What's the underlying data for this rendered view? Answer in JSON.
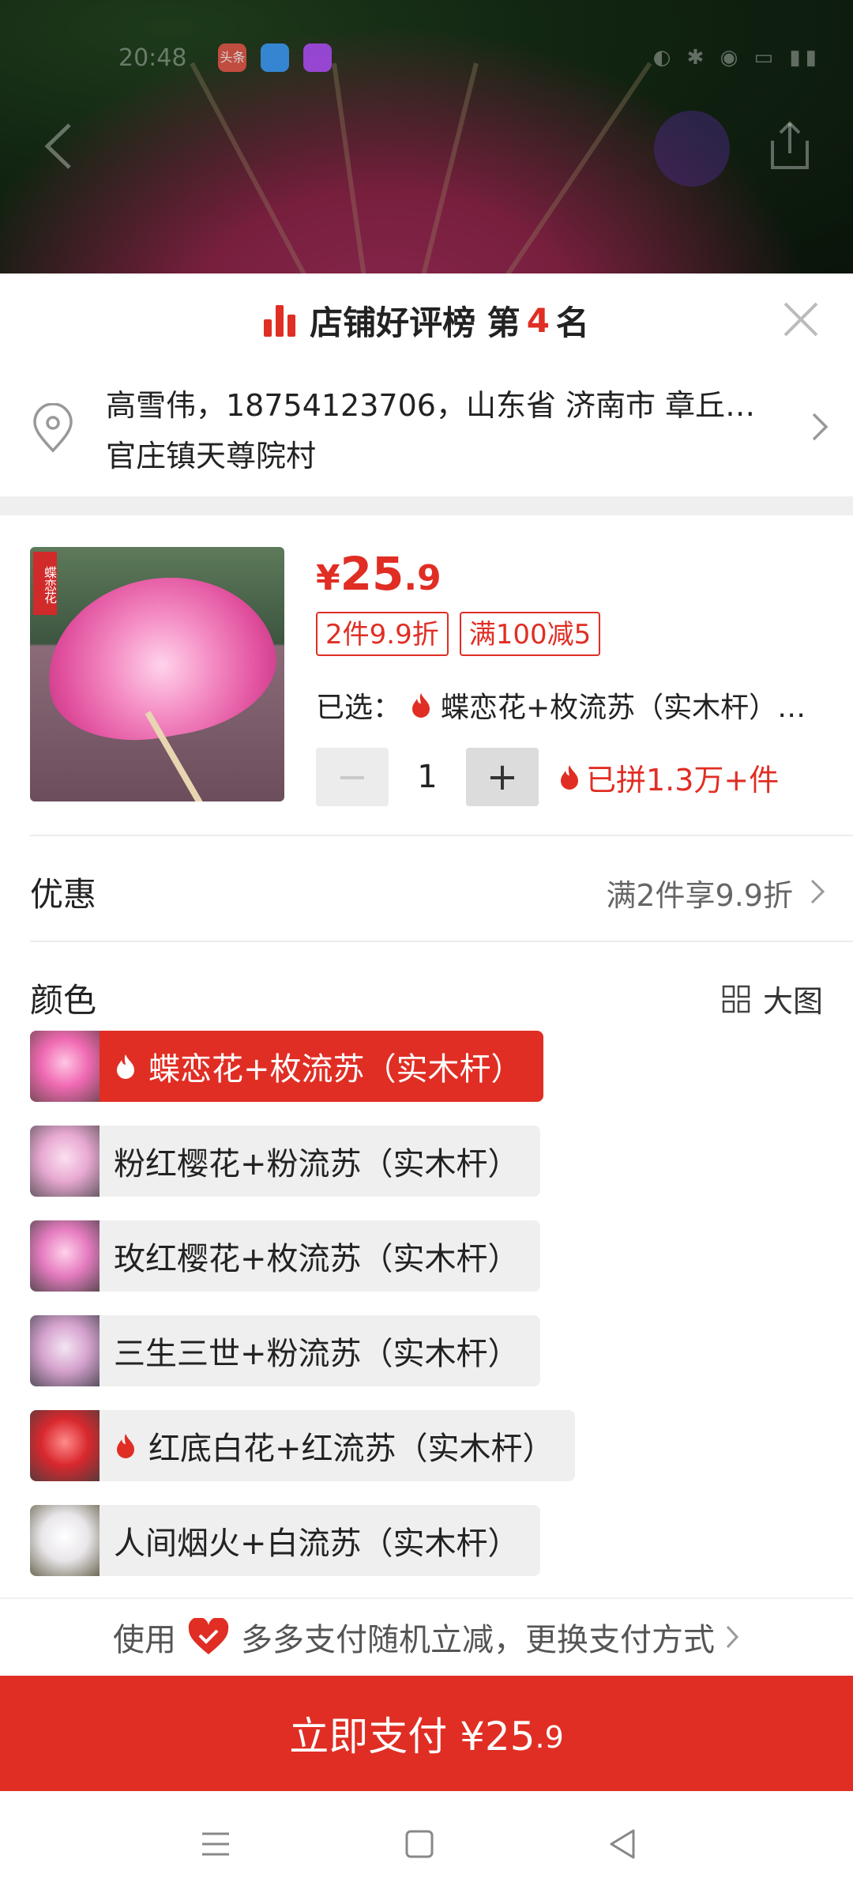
{
  "status_bar": {
    "time": "20:48",
    "apps": [
      "头条",
      "",
      ""
    ]
  },
  "top": {
    "back": "back",
    "share": "share"
  },
  "rank": {
    "prefix": "店铺好评榜 第",
    "number": "4",
    "suffix": "名"
  },
  "address": {
    "line1": "高雪伟，18754123706，山东省 济南市 章丘…",
    "line2": "官庄镇天尊院村"
  },
  "product": {
    "thumb_badge": "蝶恋花",
    "price": {
      "currency": "¥",
      "integer": "25",
      "decimal": ".9"
    },
    "tags": [
      "2件9.9折",
      "满100减5"
    ],
    "selected_label": "已选：",
    "selected_value": "蝶恋花+枚流苏（实木杆）…",
    "quantity": "1",
    "minus": "−",
    "plus": "+",
    "sold": "已拼1.3万+件"
  },
  "promo": {
    "label": "优惠",
    "value": "满2件享9.9折"
  },
  "color": {
    "label": "颜色",
    "big_view": "大图",
    "options": [
      {
        "label": "蝶恋花+枚流苏（实木杆）",
        "active": true,
        "hot": true
      },
      {
        "label": "粉红樱花+粉流苏（实木杆）",
        "active": false,
        "hot": false
      },
      {
        "label": "玫红樱花+枚流苏（实木杆）",
        "active": false,
        "hot": false
      },
      {
        "label": "三生三世+粉流苏（实木杆）",
        "active": false,
        "hot": false
      },
      {
        "label": "红底白花+红流苏（实木杆）",
        "active": false,
        "hot": true
      },
      {
        "label": "人间烟火+白流苏（实木杆）",
        "active": false,
        "hot": false
      }
    ]
  },
  "pay": {
    "prefix": "使用",
    "text": "多多支付随机立减，更换支付方式"
  },
  "buy": {
    "label": "立即支付 ¥25",
    "decimal": ".9"
  },
  "colors": {
    "accent": "#e02e24",
    "bg_gray": "#efefef"
  }
}
